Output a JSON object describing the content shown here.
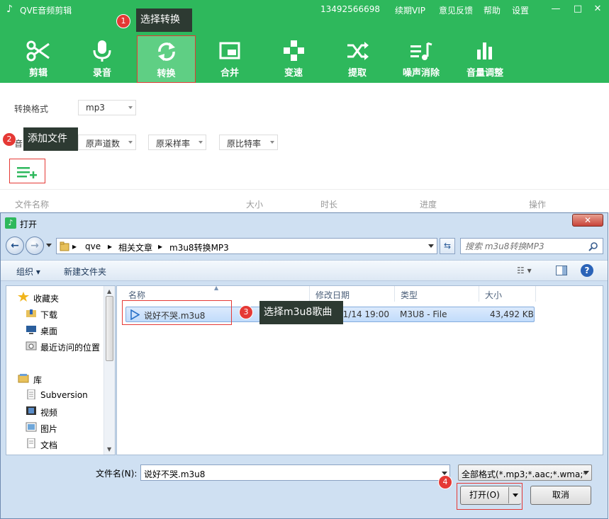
{
  "app": {
    "title": "QVE音频剪辑",
    "phone": "13492566698",
    "links": [
      "续期VIP",
      "意见反馈",
      "帮助",
      "设置"
    ],
    "window_buttons": [
      "—",
      "□",
      "✕"
    ]
  },
  "toolbar": [
    {
      "label": "剪辑",
      "icon": "scissors-icon"
    },
    {
      "label": "录音",
      "icon": "microphone-icon"
    },
    {
      "label": "转换",
      "icon": "convert-icon",
      "active": true
    },
    {
      "label": "合并",
      "icon": "merge-icon"
    },
    {
      "label": "变速",
      "icon": "speed-icon"
    },
    {
      "label": "提取",
      "icon": "extract-icon"
    },
    {
      "label": "噪声消除",
      "icon": "noise-icon"
    },
    {
      "label": "音量调整",
      "icon": "volume-icon"
    }
  ],
  "settings": {
    "format_label": "转换格式",
    "format_value": "mp3",
    "quality_label": "音",
    "channels": "原声道数",
    "sample_rate": "原采样率",
    "bitrate": "原比特率"
  },
  "file_list": {
    "columns": [
      "文件名称",
      "大小",
      "时长",
      "进度",
      "操作"
    ]
  },
  "callouts": [
    {
      "num": "1",
      "text": "选择转换"
    },
    {
      "num": "2",
      "text": "添加文件"
    },
    {
      "num": "3",
      "text": "选择m3u8歌曲"
    },
    {
      "num": "4",
      "text": ""
    }
  ],
  "dialog": {
    "title": "打开",
    "close": "✕",
    "breadcrumb": [
      "qve",
      "相关文章",
      "m3u8转换MP3"
    ],
    "search_placeholder": "搜索 m3u8转换MP3",
    "commands": {
      "organize": "组织 ▾",
      "new_folder": "新建文件夹"
    },
    "nav": [
      {
        "label": "收藏夹",
        "icon": "star-icon",
        "head": true
      },
      {
        "label": "下载",
        "icon": "download-folder-icon"
      },
      {
        "label": "桌面",
        "icon": "desktop-icon"
      },
      {
        "label": "最近访问的位置",
        "icon": "recent-places-icon"
      },
      {
        "label": "库",
        "icon": "library-icon",
        "head": true
      },
      {
        "label": "Subversion",
        "icon": "document-icon"
      },
      {
        "label": "视频",
        "icon": "video-icon"
      },
      {
        "label": "图片",
        "icon": "picture-icon"
      },
      {
        "label": "文档",
        "icon": "document-icon"
      }
    ],
    "columns": [
      "名称",
      "修改日期",
      "类型",
      "大小"
    ],
    "file": {
      "name": "说好不哭.m3u8",
      "date": "11/14 19:00",
      "type": "M3U8 - File",
      "size": "43,492 KB"
    },
    "filename_label": "文件名(N):",
    "filename_value": "说好不哭.m3u8",
    "filetype_value": "全部格式(*.mp3;*.aac;*.wma;*",
    "open_button": "打开(O)",
    "cancel_button": "取消"
  }
}
